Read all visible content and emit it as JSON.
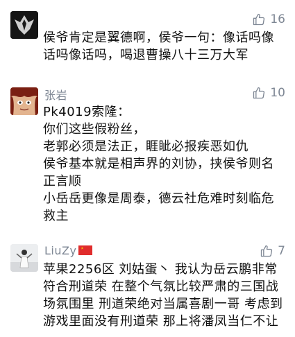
{
  "comments": [
    {
      "username": "",
      "likes": "16",
      "text": "侯爷肯定是翼德啊，侯爷一句：像话吗像话吗像话吗，喝退曹操八十三万大军"
    },
    {
      "username": "张岩",
      "likes": "10",
      "text": "Pk4019索隆：\n你们这些假粉丝，\n老郭必须是法正，睚眦必报疾恶如仇\n侯爷基本就是相声界的刘协，挟侯爷则名正言顺\n小岳岳更像是周泰，德云社危难时刻临危救主"
    },
    {
      "username": "LiuZy",
      "likes": "7",
      "text": "苹果2256区 刘姑蛋丶 我认为岳云鹏非常符合刑道荣 在整个气氛比较严肃的三国战场氛围里 刑道荣绝对当属喜剧一哥 考虑到游戏里面没有刑道荣 那上将潘凤当仁不让"
    }
  ],
  "icons": {
    "like": "thumbs-up-icon",
    "flag": "china-flag-icon"
  },
  "colors": {
    "meta": "#7e8794",
    "text": "#111111"
  }
}
